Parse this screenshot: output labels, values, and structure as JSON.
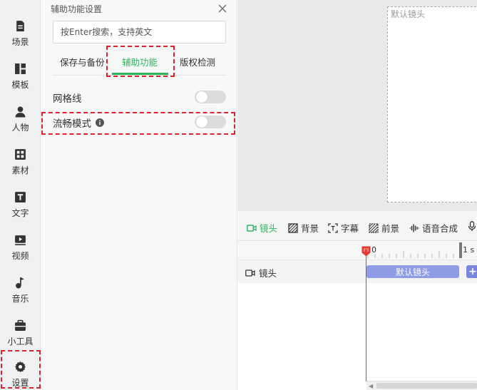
{
  "sidebar": {
    "items": [
      {
        "label": "场景",
        "icon": "scene-icon"
      },
      {
        "label": "模板",
        "icon": "template-icon"
      },
      {
        "label": "人物",
        "icon": "person-icon"
      },
      {
        "label": "素材",
        "icon": "material-icon"
      },
      {
        "label": "文字",
        "icon": "text-icon"
      },
      {
        "label": "视频",
        "icon": "video-icon"
      },
      {
        "label": "音乐",
        "icon": "music-icon"
      },
      {
        "label": "小工具",
        "icon": "toolbox-icon"
      },
      {
        "label": "设置",
        "icon": "gear-icon"
      }
    ]
  },
  "panel": {
    "title": "辅助功能设置",
    "search_placeholder": "按Enter搜索，支持英文",
    "tabs": [
      {
        "label": "保存与备份"
      },
      {
        "label": "辅助功能"
      },
      {
        "label": "版权检测"
      }
    ],
    "options": [
      {
        "label": "网格线",
        "enabled": false
      },
      {
        "label": "流畅模式",
        "enabled": false
      }
    ]
  },
  "canvas": {
    "stage_label": "默认镜头"
  },
  "timeline": {
    "tools": [
      {
        "label": "镜头",
        "icon": "camera-icon"
      },
      {
        "label": "背景",
        "icon": "background-icon"
      },
      {
        "label": "字幕",
        "icon": "subtitle-icon"
      },
      {
        "label": "前景",
        "icon": "foreground-icon"
      },
      {
        "label": "语音合成",
        "icon": "waveform-icon"
      }
    ],
    "ruler_start": "0",
    "ruler_mark": "1 s",
    "track_label": "镜头",
    "clip_label": "默认镜头",
    "add_label": "+"
  },
  "colors": {
    "accent": "#2db55d",
    "highlight": "#e0202a",
    "clip": "#8f9be5",
    "playhead": "#e53935"
  }
}
